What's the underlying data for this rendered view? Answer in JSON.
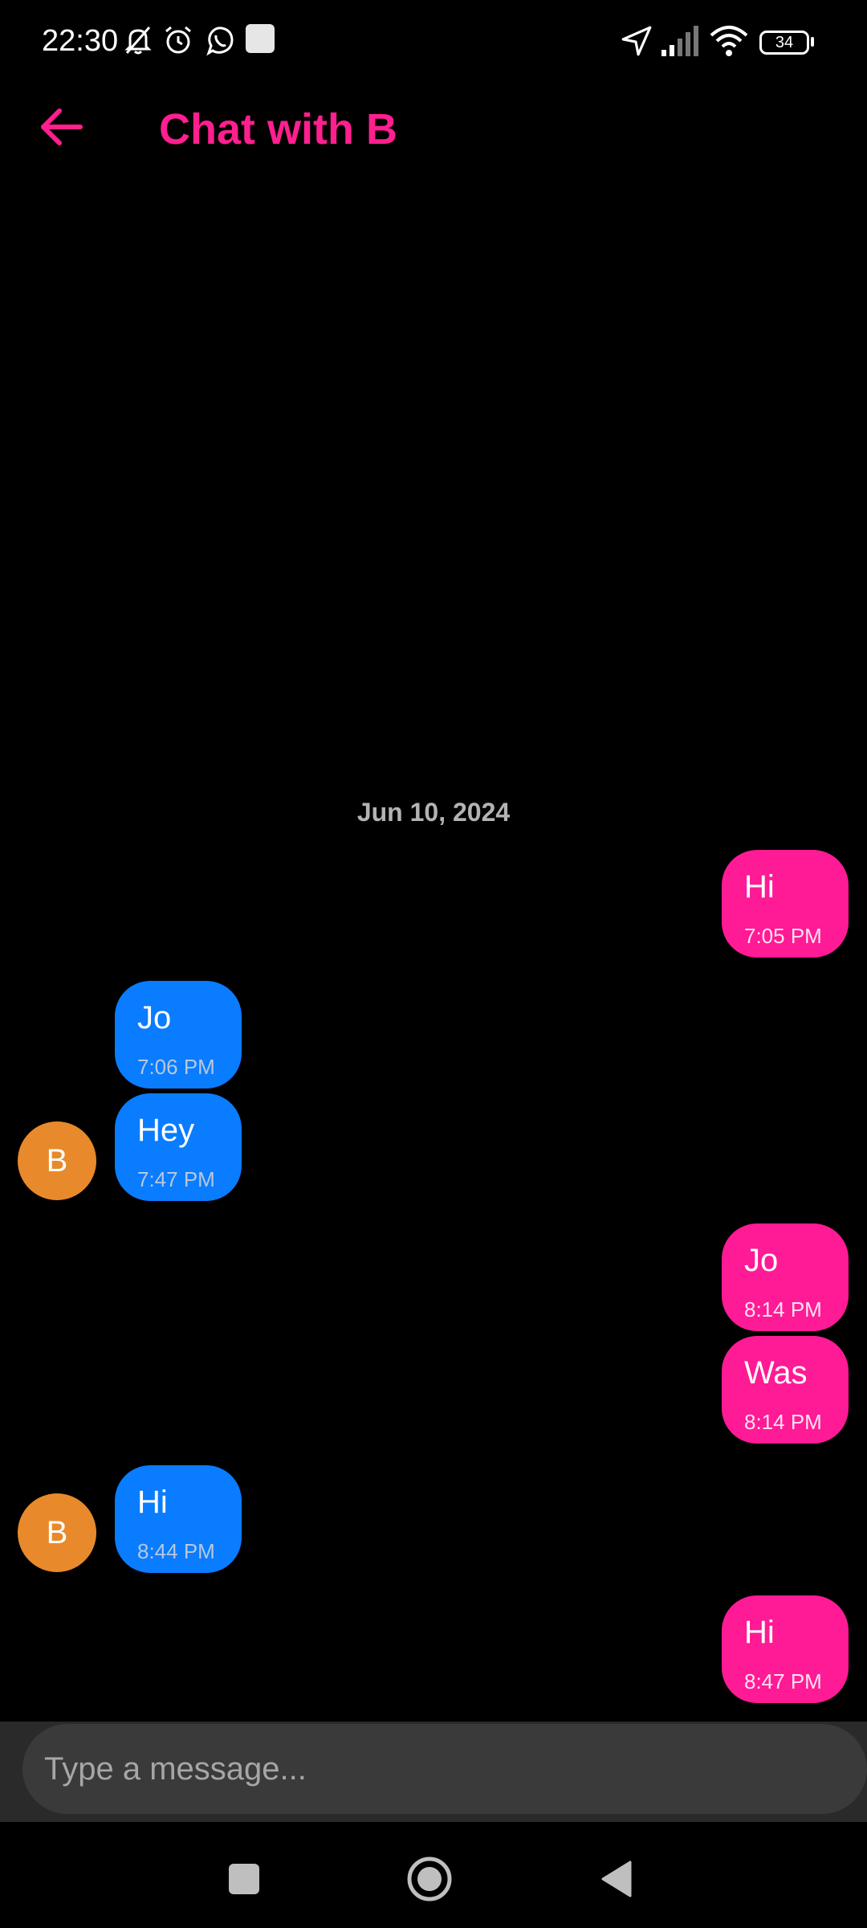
{
  "status_bar": {
    "time": "22:30",
    "left_icons": [
      "bell-off-icon",
      "alarm-icon",
      "whatsapp-icon",
      "app-square-icon"
    ],
    "right_icons": [
      "location-arrow-icon",
      "signal-icon",
      "wifi-icon",
      "battery-icon"
    ],
    "battery": "34"
  },
  "header": {
    "title": "Chat with B",
    "back_icon": "arrow-left-icon"
  },
  "colors": {
    "accent": "#ff1f8e",
    "outgoing": "#ff1a96",
    "incoming": "#0a7cff",
    "avatar": "#e88a2b"
  },
  "chat": {
    "date": "Jun 10, 2024",
    "messages": [
      {
        "direction": "outgoing",
        "text": "Hi",
        "time": "7:05 PM"
      },
      {
        "direction": "incoming",
        "text": "Jo",
        "time": "7:06 PM"
      },
      {
        "direction": "incoming",
        "text": "Hey",
        "time": "7:47 PM",
        "avatar": "B"
      },
      {
        "direction": "outgoing",
        "text": "Jo",
        "time": "8:14 PM"
      },
      {
        "direction": "outgoing",
        "text": "Was",
        "time": "8:14 PM"
      },
      {
        "direction": "incoming",
        "text": "Hi",
        "time": "8:44 PM",
        "avatar": "B"
      },
      {
        "direction": "outgoing",
        "text": "Hi",
        "time": "8:47 PM"
      }
    ]
  },
  "composer": {
    "placeholder": "Type a message..."
  },
  "nav_bar": {
    "buttons": [
      "recents-square-icon",
      "home-circle-icon",
      "back-triangle-icon"
    ]
  }
}
